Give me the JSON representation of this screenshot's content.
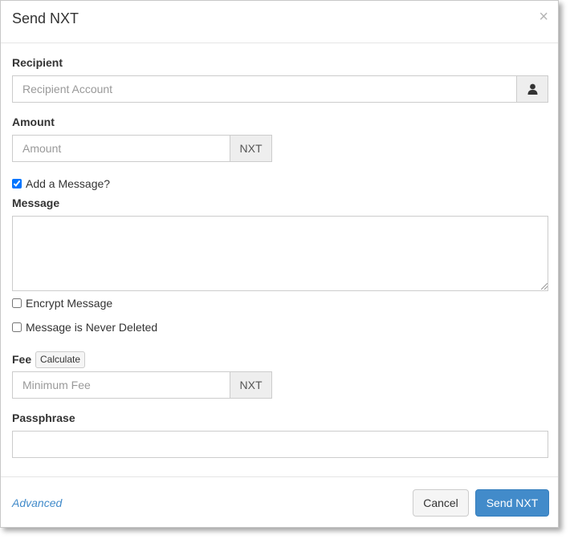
{
  "dialog": {
    "title": "Send NXT",
    "close_glyph": "×"
  },
  "recipient": {
    "label": "Recipient",
    "placeholder": "Recipient Account",
    "value": "",
    "addon_icon": "user-icon"
  },
  "amount": {
    "label": "Amount",
    "placeholder": "Amount",
    "value": "",
    "addon": "NXT"
  },
  "add_message": {
    "label": "Add a Message?",
    "checked": true
  },
  "message": {
    "label": "Message",
    "value": ""
  },
  "encrypt_message": {
    "label": "Encrypt Message",
    "checked": false
  },
  "never_deleted": {
    "label": "Message is Never Deleted",
    "checked": false
  },
  "fee": {
    "label": "Fee",
    "calculate_label": "Calculate",
    "placeholder": "Minimum Fee",
    "value": "",
    "addon": "NXT"
  },
  "passphrase": {
    "label": "Passphrase",
    "value": ""
  },
  "footer": {
    "advanced_label": "Advanced",
    "cancel_label": "Cancel",
    "send_label": "Send NXT"
  },
  "colors": {
    "primary": "#428bca",
    "link": "#428bca",
    "addon_bg": "#eeeeee",
    "border": "#cccccc"
  }
}
